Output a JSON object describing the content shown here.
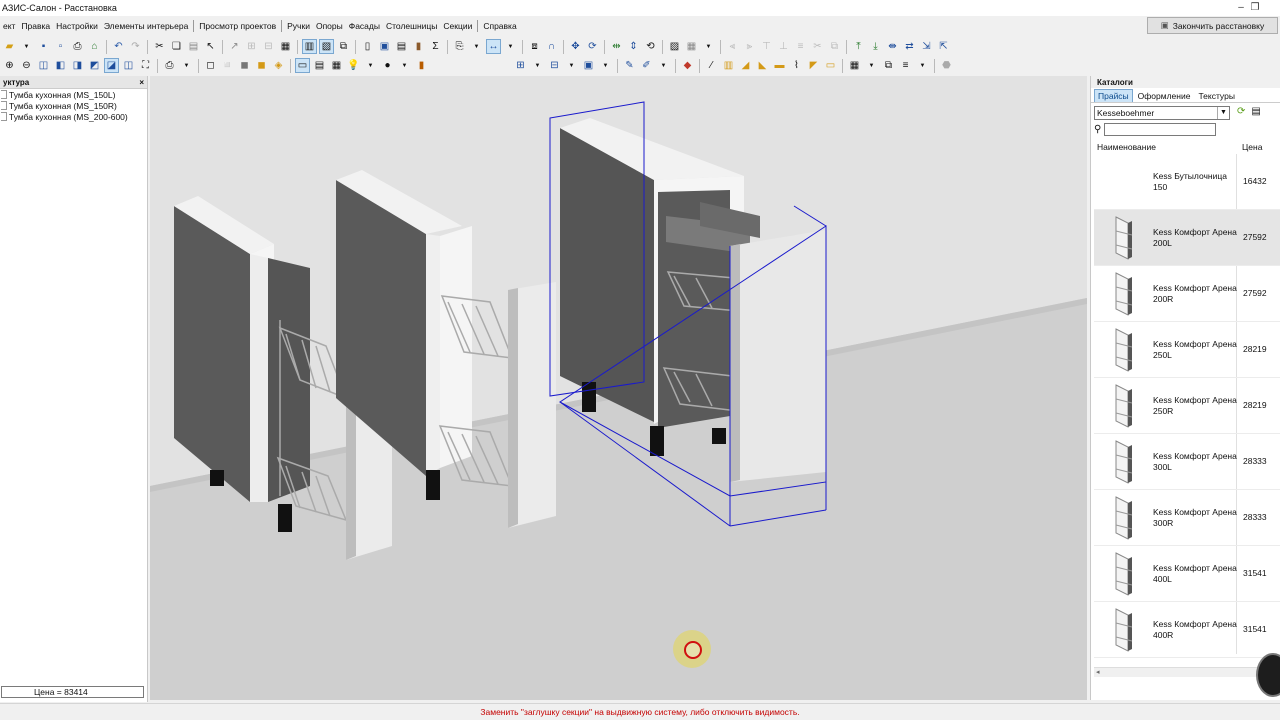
{
  "title": "АЗИС-Салон -  Расстановка",
  "menu": [
    "ект",
    "Правка",
    "Настройки",
    "Элементы интерьера",
    "Просмотр проектов",
    "Ручки",
    "Опоры",
    "Фасады",
    "Столешницы",
    "Секции",
    "Справка"
  ],
  "finish_button": "Закончить расстановку",
  "left_panel": {
    "header": "уктура",
    "items": [
      "Тумба кухонная (MS_150L)",
      "Тумба кухонная (MS_150R)",
      "Тумба кухонная (MS_200-600)"
    ],
    "price": "Цена = 83414"
  },
  "catalog": {
    "header": "Каталоги",
    "tabs": [
      "Прайсы",
      "Оформление",
      "Текстуры"
    ],
    "active_tab": "Прайсы",
    "vendor": "Kessebоehmer",
    "search_value": "",
    "columns": {
      "name": "Наименование",
      "price": "Цена"
    },
    "rows": [
      {
        "name": "Kess Бутылочница 150",
        "price": "16432",
        "selected": false
      },
      {
        "name": "Kess Комфорт Арена 200L",
        "price": "27592",
        "selected": true
      },
      {
        "name": "Kess Комфорт Арена 200R",
        "price": "27592",
        "selected": false
      },
      {
        "name": "Kess Комфорт Арена 250L",
        "price": "28219",
        "selected": false
      },
      {
        "name": "Kess Комфорт Арена 250R",
        "price": "28219",
        "selected": false
      },
      {
        "name": "Kess Комфорт Арена 300L",
        "price": "28333",
        "selected": false
      },
      {
        "name": "Kess Комфорт Арена 300R",
        "price": "28333",
        "selected": false
      },
      {
        "name": "Kess Комфорт Арена 400L",
        "price": "31541",
        "selected": false
      },
      {
        "name": "Kess Комфорт Арена 400R",
        "price": "31541",
        "selected": false
      }
    ]
  },
  "status_message": "Заменить \"заглушку секции\" на выдвижную систему, либо отключить видимость.",
  "colors": {
    "selection": "#0000cc",
    "status_text": "#c40000",
    "active_tab": "#cce4f7"
  }
}
